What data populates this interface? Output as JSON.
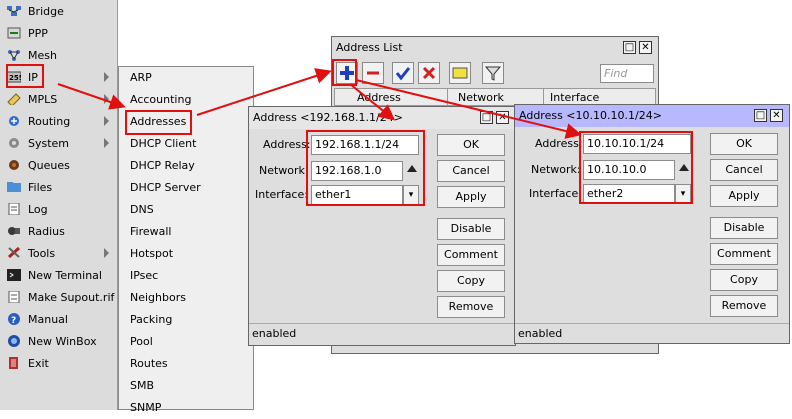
{
  "sidebar": {
    "items": [
      {
        "label": "Bridge",
        "icon": "bridge-icon"
      },
      {
        "label": "PPP",
        "icon": "ppp-icon"
      },
      {
        "label": "Mesh",
        "icon": "mesh-icon"
      },
      {
        "label": "IP",
        "icon": "ip-icon",
        "submenu": true
      },
      {
        "label": "MPLS",
        "icon": "mpls-icon",
        "submenu": true
      },
      {
        "label": "Routing",
        "icon": "routing-icon",
        "submenu": true
      },
      {
        "label": "System",
        "icon": "system-icon",
        "submenu": true
      },
      {
        "label": "Queues",
        "icon": "queues-icon"
      },
      {
        "label": "Files",
        "icon": "files-icon"
      },
      {
        "label": "Log",
        "icon": "log-icon"
      },
      {
        "label": "Radius",
        "icon": "radius-icon"
      },
      {
        "label": "Tools",
        "icon": "tools-icon",
        "submenu": true
      },
      {
        "label": "New Terminal",
        "icon": "terminal-icon"
      },
      {
        "label": "Make Supout.rif",
        "icon": "supout-icon"
      },
      {
        "label": "Manual",
        "icon": "manual-icon"
      },
      {
        "label": "New WinBox",
        "icon": "winbox-icon"
      },
      {
        "label": "Exit",
        "icon": "exit-icon"
      }
    ]
  },
  "ip_submenu": {
    "items": [
      "ARP",
      "Accounting",
      "Addresses",
      "DHCP Client",
      "DHCP Relay",
      "DHCP Server",
      "DNS",
      "Firewall",
      "Hotspot",
      "IPsec",
      "Neighbors",
      "Packing",
      "Pool",
      "Routes",
      "SMB",
      "SNMP"
    ]
  },
  "address_list": {
    "title": "Address List",
    "find_placeholder": "Find",
    "columns": [
      "Address",
      "Network",
      "Interface"
    ]
  },
  "dialog1": {
    "title": "Address <192.168.1.1/24>",
    "address_label": "Address:",
    "address_value": "192.168.1.1/24",
    "network_label": "Network:",
    "network_value": "192.168.1.0",
    "interface_label": "Interface:",
    "interface_value": "ether1",
    "buttons": {
      "ok": "OK",
      "cancel": "Cancel",
      "apply": "Apply",
      "disable": "Disable",
      "comment": "Comment",
      "copy": "Copy",
      "remove": "Remove"
    },
    "status": "enabled"
  },
  "dialog2": {
    "title": "Address <10.10.10.1/24>",
    "address_label": "Address:",
    "address_value": "10.10.10.1/24",
    "network_label": "Network:",
    "network_value": "10.10.10.0",
    "interface_label": "Interface:",
    "interface_value": "ether2",
    "buttons": {
      "ok": "OK",
      "cancel": "Cancel",
      "apply": "Apply",
      "disable": "Disable",
      "comment": "Comment",
      "copy": "Copy",
      "remove": "Remove"
    },
    "status": "enabled"
  },
  "colors": {
    "annotation": "#e01010",
    "active_title": "#b8b8ff",
    "toolbar_add": "#1a3fbf"
  }
}
